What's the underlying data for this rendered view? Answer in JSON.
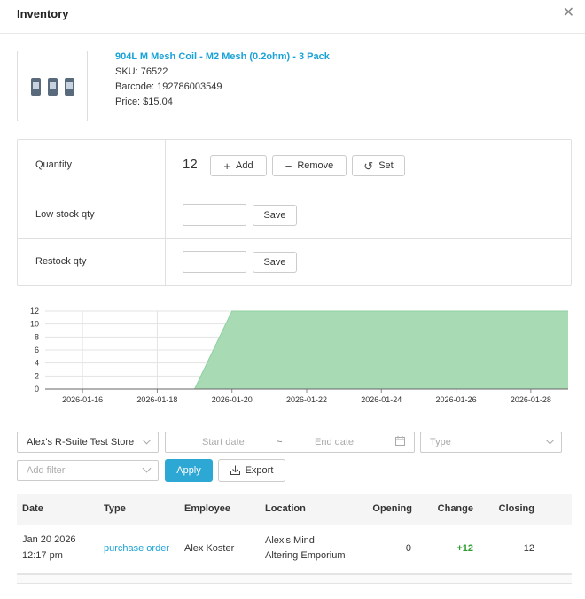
{
  "modal": {
    "title": "Inventory"
  },
  "product": {
    "name": "904L M Mesh Coil - M2 Mesh (0.2ohm) - 3 Pack",
    "sku": "SKU: 76522",
    "barcode": "Barcode: 192786003549",
    "price": "Price: $15.04"
  },
  "inventory": {
    "quantity_label": "Quantity",
    "quantity_value": "12",
    "add_label": "Add",
    "remove_label": "Remove",
    "set_label": "Set",
    "low_stock_label": "Low stock qty",
    "low_stock_value": "",
    "restock_label": "Restock qty",
    "restock_value": "",
    "save_label": "Save"
  },
  "chart_data": {
    "type": "area",
    "x": [
      "2026-01-15",
      "2026-01-19",
      "2026-01-20",
      "2026-01-29"
    ],
    "values": [
      0,
      0,
      12,
      12
    ],
    "x_ticks": [
      "2026-01-16",
      "2026-01-18",
      "2026-01-20",
      "2026-01-22",
      "2026-01-24",
      "2026-01-26",
      "2026-01-28"
    ],
    "y_ticks": [
      0,
      2,
      4,
      6,
      8,
      10,
      12
    ],
    "ylim": [
      0,
      12
    ],
    "xlim": [
      "2026-01-15",
      "2026-01-29"
    ],
    "grid": true,
    "color": "#a8dbb4",
    "title": "",
    "xlabel": "",
    "ylabel": ""
  },
  "filters": {
    "store": "Alex's R-Suite Test Store",
    "start_placeholder": "Start date",
    "end_placeholder": "End date",
    "separator": "~",
    "type_placeholder": "Type",
    "add_filter_placeholder": "Add filter",
    "apply_label": "Apply",
    "export_label": "Export"
  },
  "history": {
    "columns": [
      "Date",
      "Type",
      "Employee",
      "Location",
      "Opening",
      "Change",
      "Closing"
    ],
    "rows": [
      {
        "date": "Jan 20 2026",
        "time": "12:17 pm",
        "type": "purchase order",
        "employee": "Alex Koster",
        "location_line1": "Alex's Mind",
        "location_line2": "Altering Emporium",
        "opening": "0",
        "change": "+12",
        "closing": "12"
      }
    ]
  }
}
